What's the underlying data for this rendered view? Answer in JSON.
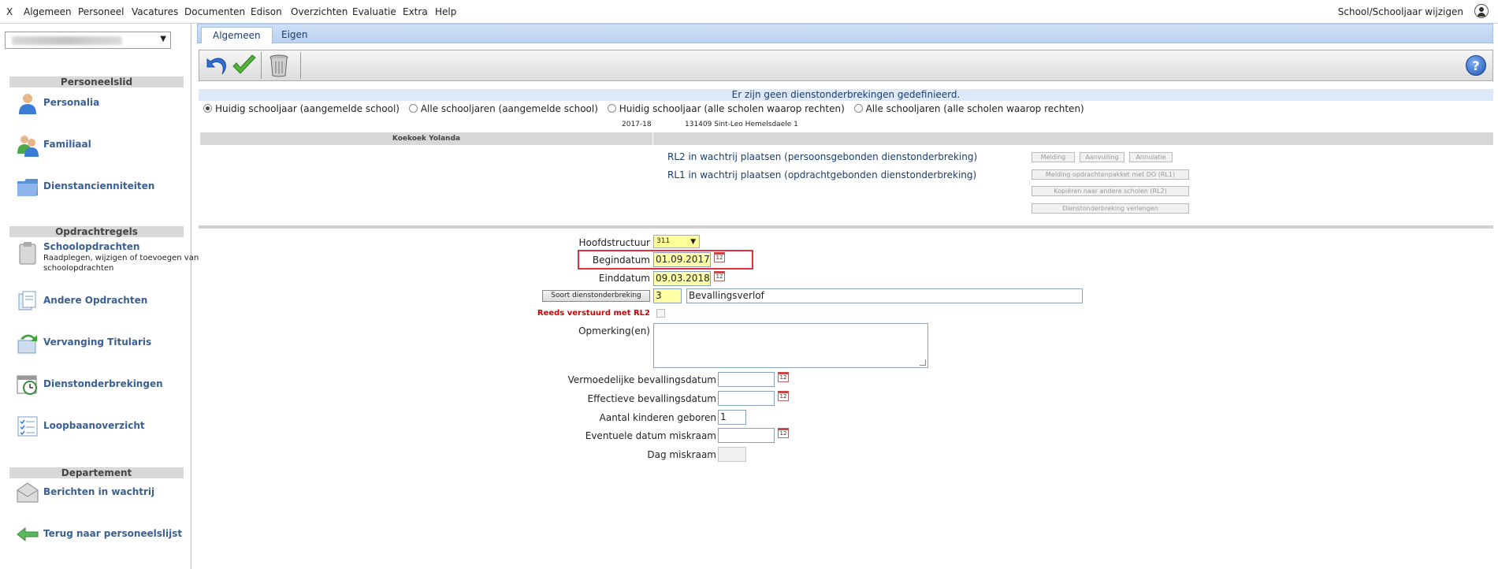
{
  "menu": {
    "close": "X",
    "items": [
      "Algemeen",
      "Personeel",
      "Vacatures",
      "Documenten",
      "Edison",
      "Overzichten",
      "Evaluatie",
      "Extra",
      "Help"
    ],
    "right": "School/Schooljaar wijzigen"
  },
  "sidebar": {
    "select_arrow": "▼",
    "sections": {
      "personeelslid": "Personeelslid",
      "opdrachtregels": "Opdrachtregels",
      "departement": "Departement"
    },
    "items": {
      "personalia": "Personalia",
      "familiaal": "Familiaal",
      "dienstancienniteiten": "Dienstancienniteiten",
      "schoolopdrachten": "Schoolopdrachten",
      "schoolopdrachten_sub": "Raadplegen, wijzigen of toevoegen van schoolopdrachten",
      "andere_opdrachten": "Andere Opdrachten",
      "vervanging_titularis": "Vervanging Titularis",
      "dienstonderbrekingen": "Dienstonderbrekingen",
      "loopbaanoverzicht": "Loopbaanoverzicht",
      "berichten_wachtrij": "Berichten in wachtrij",
      "terug": "Terug naar personeelslijst"
    }
  },
  "tabs": {
    "algemeen": "Algemeen",
    "eigen": "Eigen"
  },
  "toolbar": {
    "help": "?"
  },
  "info": "Er zijn geen dienstonderbrekingen gedefinieerd.",
  "filters": {
    "huidig_aangemeld": "Huidig schooljaar (aangemelde school)",
    "alle_aangemeld": "Alle schooljaren (aangemelde school)",
    "huidig_alle": "Huidig schooljaar (alle scholen waarop rechten)",
    "alle_alle": "Alle schooljaren (alle scholen waarop rechten)"
  },
  "school_year": "2017-18",
  "school": "131409 Sint-Leo Hemelsdaele 1",
  "person_name": "Koekoek Yolanda",
  "rl2_text": "RL2 in wachtrij plaatsen (persoonsgebonden dienstonderbreking)",
  "rl1_text": "RL1 in wachtrij plaatsen (opdrachtgebonden dienstonderbreking)",
  "action_buttons": {
    "melding": "Melding",
    "aanvulling": "Aanvulling",
    "annulatie": "Annulatie",
    "melding_rl1": "Melding opdrachtenpakket met DO (RL1)",
    "kopieren": "Kopiëren naar andere scholen (RL2)",
    "verlengen": "Dienstonderbreking verlengen"
  },
  "form": {
    "hoofdstructuur_label": "Hoofdstructuur",
    "hoofdstructuur_value": "311",
    "select_arrow": "▼",
    "begindatum_label": "Begindatum",
    "begindatum_value": "01.09.2017",
    "einddatum_label": "Einddatum",
    "einddatum_value": "09.03.2018",
    "soort_button": "Soort dienstonderbreking",
    "soort_code": "3",
    "soort_desc": "Bevallingsverlof",
    "reeds_label": "Reeds verstuurd met RL2",
    "opmerking_label": "Opmerking(en)",
    "vermoedelijke_label": "Vermoedelijke bevallingsdatum",
    "effectieve_label": "Effectieve bevallingsdatum",
    "aantal_label": "Aantal kinderen geboren",
    "aantal_value": "1",
    "miskraam_datum_label": "Eventuele datum miskraam",
    "dag_miskraam_label": "Dag miskraam",
    "calendar_glyph": "12"
  }
}
